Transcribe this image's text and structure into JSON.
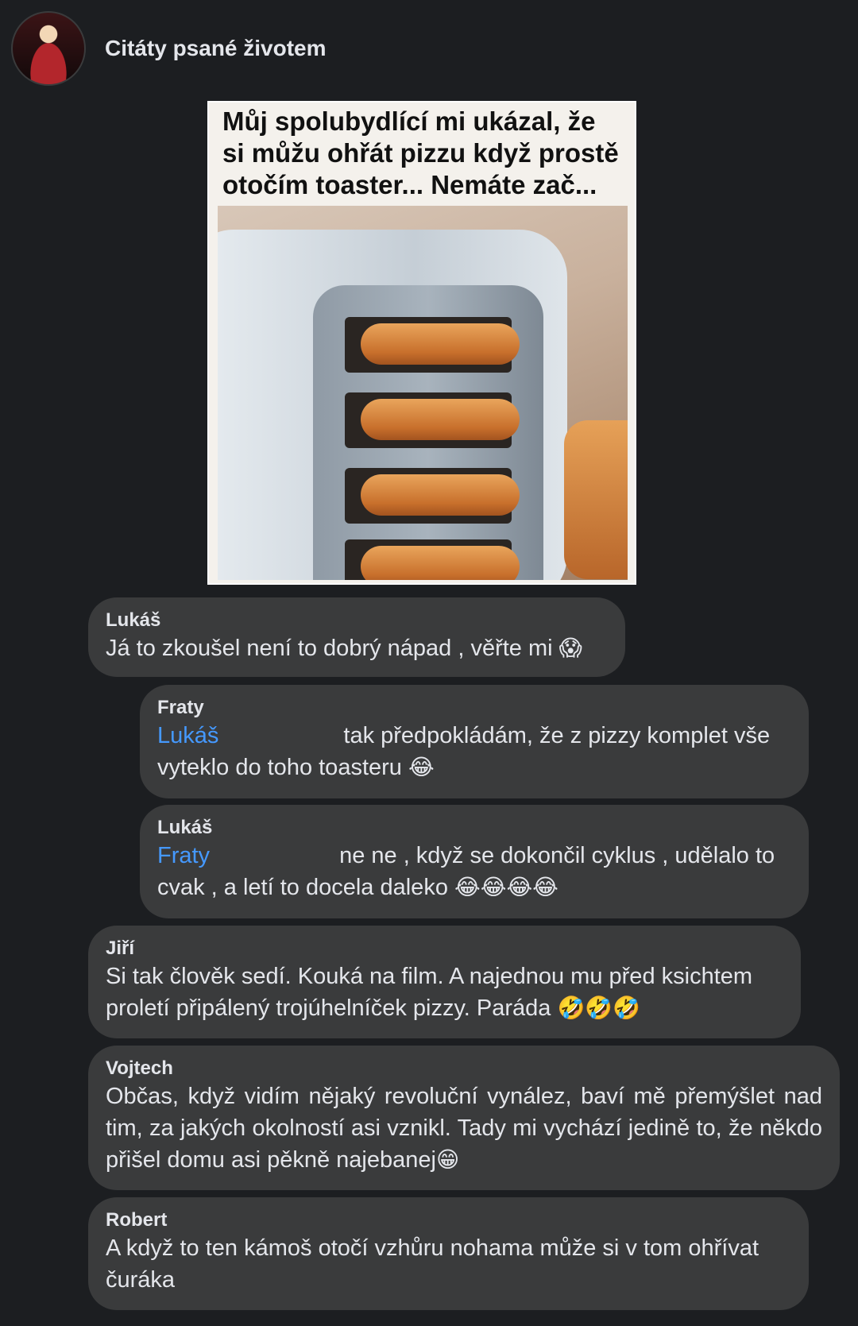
{
  "header": {
    "page_name": "Citáty psané životem"
  },
  "post": {
    "image_caption": "Můj spolubydlící mi ukázal, že si můžu ohřát pizzu když prostě otočím toaster... Nemáte zač..."
  },
  "comments": [
    {
      "author": "Lukáš",
      "text": "Já to zkoušel není to dobrý nápad , věřte mi",
      "emoji": "😱"
    },
    {
      "author": "Fraty",
      "mention": "Lukáš",
      "text": "tak předpokládám, že z pizzy komplet vše vyteklo do toho toasteru",
      "emoji": "😂"
    },
    {
      "author": "Lukáš",
      "mention": "Fraty",
      "text": "ne ne , když se dokončil cyklus , udělalo to cvak , a letí to docela daleko",
      "emoji": "😂😂😂😂"
    },
    {
      "author": "Jiří",
      "text": "Si tak člověk sedí. Kouká na film. A najednou mu před ksichtem proletí připálený trojúhelníček pizzy. Paráda",
      "emoji": "🤣🤣🤣"
    },
    {
      "author": "Vojtech",
      "text": "Občas, když vidím nějaký revoluční vynález, baví mě přemýšlet nad tim, za jakých okolností asi vznikl. Tady mi vychází jedině to, že někdo přišel domu asi pěkně najebanej",
      "emoji": "😁"
    },
    {
      "author": "Robert",
      "text": "A když to ten kámoš otočí vzhůru nohama může si v tom ohřívat čuráka"
    }
  ]
}
